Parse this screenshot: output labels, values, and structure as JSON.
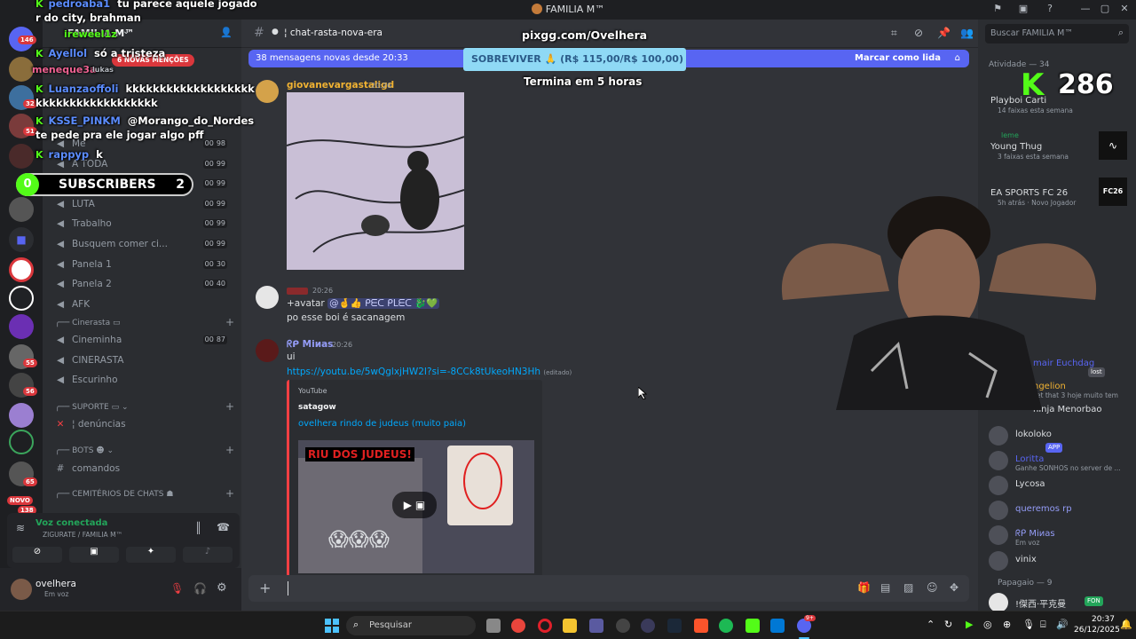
{
  "window": {
    "title": "FAMILIA M™"
  },
  "servers": {
    "badges": [
      "146",
      "32",
      "51",
      "55",
      "56",
      "65",
      "138"
    ],
    "novo_label": "NOVO"
  },
  "guild": {
    "name": "FAMILIA M™",
    "mentions_pill": "6 NOVAS MENÇÕES"
  },
  "channels": {
    "rows": [
      {
        "name": "Me",
        "count": "98",
        "icon": "speaker-icon"
      },
      {
        "name": "A TODA",
        "count": "99",
        "icon": "speaker-icon"
      },
      {
        "name": "TROPA",
        "count": "99",
        "icon": "speaker-icon"
      },
      {
        "name": "LUTA",
        "count": "99",
        "icon": "speaker-icon"
      },
      {
        "name": "Trabalho",
        "count": "99",
        "icon": "speaker-icon"
      },
      {
        "name": "Busquem comer ci...",
        "count": "99",
        "icon": "speaker-icon"
      },
      {
        "name": "Panela 1",
        "count": "30",
        "icon": "speaker-icon"
      },
      {
        "name": "Panela 2",
        "count": "40",
        "icon": "speaker-icon"
      },
      {
        "name": "AFK",
        "count": "",
        "icon": "speaker-icon"
      }
    ],
    "count_prefix": "00",
    "cat_cinerasta": "Cinerasta",
    "cinerasta_rows": [
      {
        "name": "Cineminha",
        "count": "87"
      },
      {
        "name": "CINERASTA",
        "count": ""
      },
      {
        "name": "Escurinho",
        "count": ""
      }
    ],
    "cat_suporte": "SUPORTE",
    "suporte_rows": [
      {
        "name": "denúncias"
      }
    ],
    "cat_bots": "BOTS",
    "bots_rows": [
      {
        "name": "comandos"
      }
    ],
    "cat_cemiterios": "CEMITÉRIOS DE CHATS"
  },
  "voice": {
    "status": "Voz conectada",
    "channel": "ZIGURATE / FAMILIA M™"
  },
  "user": {
    "name": "ovelhera",
    "status": "Em voz"
  },
  "chat": {
    "channel_name": "chat-rasta-nova-era",
    "new_messages": "38 mensagens novas desde 20:33",
    "mark_read": "Marcar como lida",
    "messages": [
      {
        "author": "giovanevargastaligd",
        "time": "20:26",
        "author_color": "#f0b232"
      },
      {
        "author": "",
        "time": "20:26",
        "author_color": "#f23f43",
        "line1_prefix": "+avatar",
        "line1_tag": "ᑭᗴᑕ ᑭᒪᗴᑕ",
        "line2": "po esse boi é sacanagem"
      },
      {
        "author": "ᖇᑭ Miиas",
        "time": "20:26",
        "author_color": "#5865f2",
        "line1": "ui",
        "link": "https://youtu.be/5wQglxjHW2I?si=-8CCk8tUkeoHN3Hh",
        "edited": "(editado)"
      }
    ],
    "embed": {
      "provider": "YouTube",
      "author": "satagow",
      "title": "ovelhera rindo de judeus (muito paia)",
      "thumb_caption": "RIU DOS JUDEUS!"
    }
  },
  "search": {
    "placeholder": "Buscar FAMILIA M™"
  },
  "members": {
    "activity_header": "Atividade — 34",
    "activity": [
      {
        "name": "Playboi Carti",
        "sub": "14 faixas esta semana",
        "tag": ""
      },
      {
        "name": "Young Thug",
        "sub": "3 faixas esta semana",
        "tag": "leme"
      },
      {
        "name": "EA SPORTS FC 26",
        "sub": "5h atrás · Novo Jogador",
        "tag": ""
      }
    ],
    "list": [
      {
        "name": "mair Euchdag",
        "sub": "",
        "color": "#5865f2"
      },
      {
        "name": "ngelion",
        "sub": "set that 3 hoje muito tem",
        "color": "#f0b232"
      },
      {
        "name": "ninja Menorbao",
        "sub": "",
        "color": "#dbdee1"
      },
      {
        "name": "lokoloko",
        "sub": "",
        "color": "#dbdee1"
      },
      {
        "name": "Loritta",
        "sub": "Ganhe SONHOS no server de ...",
        "color": "#5865f2"
      },
      {
        "name": "Lycosa",
        "sub": "",
        "color": "#dbdee1"
      },
      {
        "name": "queremos rp",
        "sub": "",
        "color": "#949cf7"
      },
      {
        "name": "ᖇᑭ Miиas",
        "sub": "Em voz",
        "color": "#949cf7"
      },
      {
        "name": "vinix",
        "sub": "",
        "color": "#dbdee1"
      }
    ],
    "app_tag": "APP",
    "lost_tag": "lost",
    "papagaio_header": "Papagaio — 9",
    "last_member": "!傑西·平克曼",
    "fon_tag": "FON"
  },
  "taskbar": {
    "search": "Pesquisar",
    "time": "20:37",
    "date": "26/12/2025",
    "notif": "9+"
  },
  "overlay": {
    "chat_lines": [
      {
        "user": "pedroaba1",
        "text": "tu parece aquele jogador do city, brahman"
      },
      {
        "user": "Ayellol",
        "text": "só a tristeza"
      },
      {
        "user": "Luanzaoffoli",
        "text": "kkkkkkkkkkkkkkkkkkkkkkkkkkkkkkkkkkkkk"
      },
      {
        "user": "KSSE_PINKM",
        "text": "@Morango_do_Nordeste pede pra ele jogar algo pff"
      },
      {
        "user": "rappyp",
        "text": "k"
      }
    ],
    "overlay_misc": [
      "ireweel1z",
      "meneque3a",
      "lukas"
    ],
    "subscribers_label": "SUBSCRIBERS",
    "subscribers_left": "0",
    "subscribers_right": "2",
    "url": "pixgg.com/Ovelhera",
    "goal": "SOBREVIVER 🙏 (R$ 115,00/R$ 100,00)",
    "goal_ends": "Termina em 5 horas",
    "kick_viewers": "286"
  },
  "colors": {
    "accent": "#5865f2",
    "kick": "#53fc18",
    "danger": "#da373c"
  }
}
